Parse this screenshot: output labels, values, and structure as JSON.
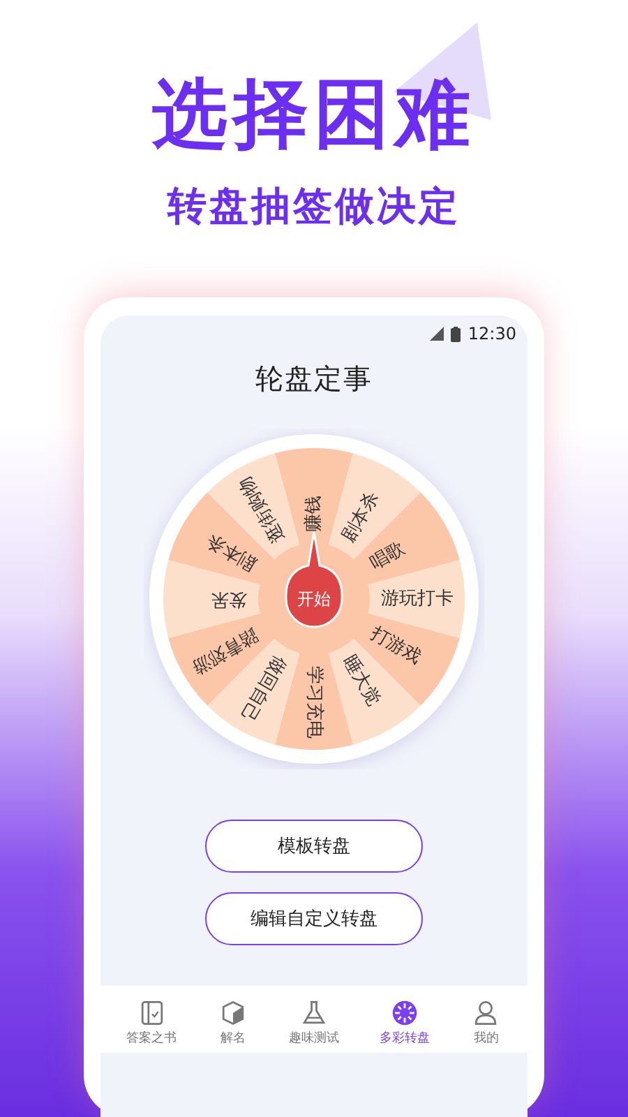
{
  "headline": "选择困难",
  "subtitle": "转盘抽签做决定",
  "status_bar": {
    "time": "12:30"
  },
  "app_title": "轮盘定事",
  "wheel": {
    "start_label": "开始",
    "segments": [
      {
        "label": "游玩打卡",
        "color": "#fde0cc"
      },
      {
        "label": "打游戏",
        "color": "#fbc7a8"
      },
      {
        "label": "睡大觉",
        "color": "#fde0cc"
      },
      {
        "label": "学习充电",
        "color": "#fbc7a8"
      },
      {
        "label": "做回自己",
        "color": "#fde0cc"
      },
      {
        "label": "踏青郊游",
        "color": "#fbc7a8"
      },
      {
        "label": "发呆",
        "color": "#fde0cc"
      },
      {
        "label": "剧本杀",
        "color": "#fbc7a8"
      },
      {
        "label": "逛街购物",
        "color": "#fde0cc"
      },
      {
        "label": "赚钱",
        "color": "#fbc7a8"
      },
      {
        "label": "剧本杀",
        "color": "#fde0cc"
      },
      {
        "label": "唱歌",
        "color": "#fbc7a8"
      }
    ]
  },
  "buttons": [
    "模板转盘",
    "编辑自定义转盘"
  ],
  "nav": [
    {
      "label": "答案之书",
      "kind": "book",
      "selected": false
    },
    {
      "label": "解名",
      "kind": "cube",
      "selected": false
    },
    {
      "label": "趣味测试",
      "kind": "flask",
      "selected": false
    },
    {
      "label": "多彩转盘",
      "kind": "wheel",
      "selected": true
    },
    {
      "label": "我的",
      "kind": "person",
      "selected": false
    }
  ]
}
